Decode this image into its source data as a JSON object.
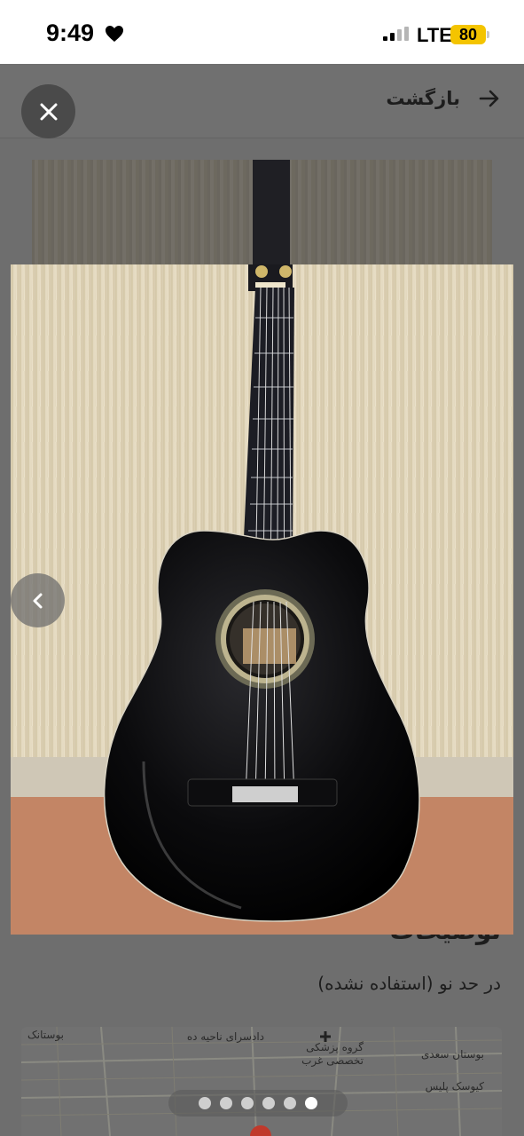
{
  "status_bar": {
    "time": "9:49",
    "network": "LTE",
    "battery": "80"
  },
  "header": {
    "back_label": "بازگشت"
  },
  "gallery": {
    "total_images": 6,
    "active_index": 5
  },
  "description": {
    "heading": "توضیحات",
    "text": "در حد نو (استفاده نشده)"
  },
  "map": {
    "labels": [
      "بوستانک",
      "دادسرای ناحیه ده",
      "گروه پزشکی",
      "تخصصی غرب",
      "بوستان سعدی",
      "کیوسک پلیس"
    ]
  },
  "icons": {
    "close": "close-icon",
    "back": "arrow-right-icon",
    "prev": "chevron-left-icon"
  }
}
